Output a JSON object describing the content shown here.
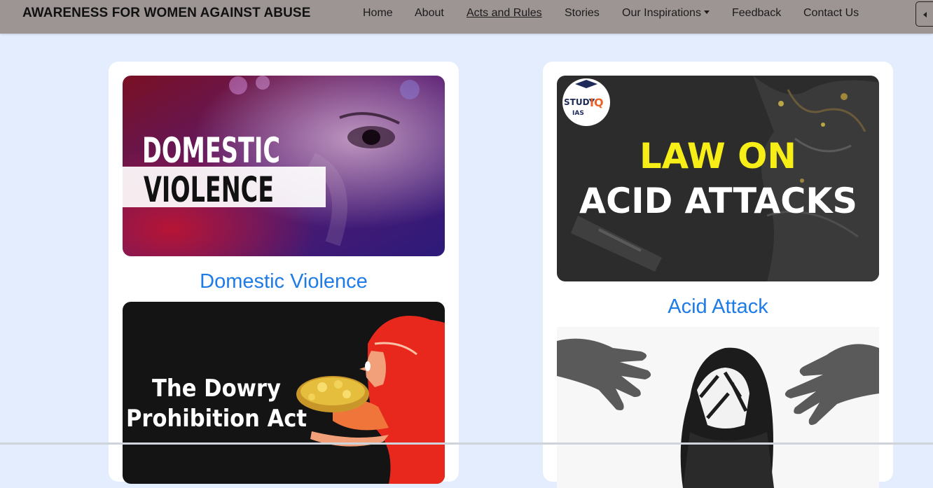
{
  "navbar": {
    "brand": "AWARENESS FOR WOMEN AGAINST ABUSE",
    "links": [
      {
        "label": "Home"
      },
      {
        "label": "About"
      },
      {
        "label": "Acts and Rules"
      },
      {
        "label": "Stories"
      },
      {
        "label": "Our Inspirations"
      },
      {
        "label": "Feedback"
      },
      {
        "label": "Contact Us"
      }
    ]
  },
  "cards": [
    {
      "image_text": [
        "DOMESTIC",
        "VIOLENCE"
      ],
      "title": "Domestic Violence",
      "second_image_text": [
        "The Dowry",
        "Prohibition Act"
      ]
    },
    {
      "logo_text": [
        "STUDY",
        "IQ",
        "IAS"
      ],
      "image_text": [
        "LAW ON",
        "ACID ATTACKS"
      ],
      "title": "Acid Attack"
    }
  ],
  "colors": {
    "navbar_bg": "#9d9593",
    "page_bg": "#e3edfd",
    "link_accent": "#1f7be6",
    "law_on_yellow": "#f7ee17"
  }
}
